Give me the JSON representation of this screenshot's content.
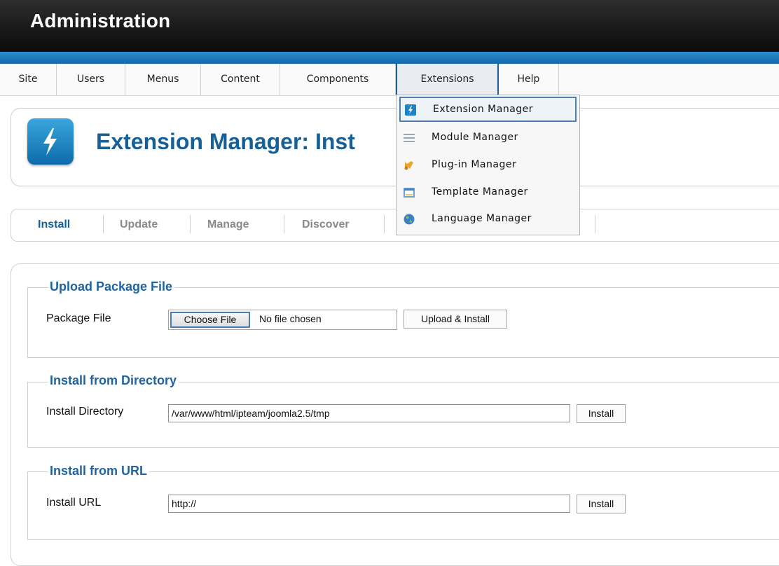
{
  "header": {
    "title": "Administration"
  },
  "menu": {
    "items": [
      "Site",
      "Users",
      "Menus",
      "Content",
      "Components",
      "Extensions",
      "Help"
    ],
    "active": "Extensions"
  },
  "dropdown": {
    "items": [
      {
        "label": "Extension Manager",
        "icon": "extension-icon"
      },
      {
        "label": "Module Manager",
        "icon": "module-icon"
      },
      {
        "label": "Plug-in Manager",
        "icon": "plugin-icon"
      },
      {
        "label": "Template Manager",
        "icon": "template-icon"
      },
      {
        "label": "Language Manager",
        "icon": "language-icon"
      }
    ],
    "selected": "Extension Manager"
  },
  "page": {
    "title": "Extension Manager: Inst"
  },
  "tabs": [
    "Install",
    "Update",
    "Manage",
    "Discover"
  ],
  "active_tab": "Install",
  "upload": {
    "legend": "Upload Package File",
    "label": "Package File",
    "choose_button": "Choose File",
    "no_file_text": "No file chosen",
    "submit": "Upload & Install"
  },
  "directory": {
    "legend": "Install from Directory",
    "label": "Install Directory",
    "value": "/var/www/html/ipteam/joomla2.5/tmp",
    "submit": "Install"
  },
  "url": {
    "legend": "Install from URL",
    "label": "Install URL",
    "value": "http://",
    "submit": "Install"
  },
  "colors": {
    "accent": "#185f96",
    "strip": "#1a7ac0"
  }
}
